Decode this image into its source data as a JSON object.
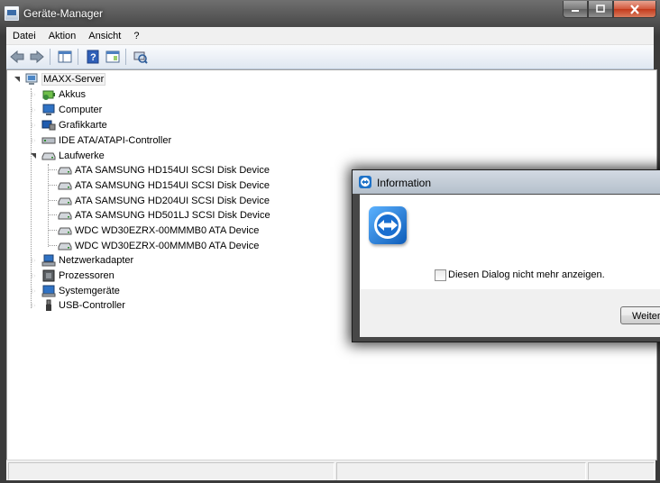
{
  "window": {
    "title": "Geräte-Manager"
  },
  "menu": [
    "Datei",
    "Aktion",
    "Ansicht",
    "?"
  ],
  "tree": {
    "root": "MAXX-Server",
    "categories": [
      {
        "label": "Akkus",
        "icon": "battery-icon",
        "expanded": false
      },
      {
        "label": "Computer",
        "icon": "computer-icon",
        "expanded": false
      },
      {
        "label": "Grafikkarte",
        "icon": "display-adapter-icon",
        "expanded": false
      },
      {
        "label": "IDE ATA/ATAPI-Controller",
        "icon": "ide-controller-icon",
        "expanded": false
      },
      {
        "label": "Laufwerke",
        "icon": "disk-drive-icon",
        "expanded": true,
        "children": [
          "ATA SAMSUNG HD154UI SCSI Disk Device",
          "ATA SAMSUNG HD154UI SCSI Disk Device",
          "ATA SAMSUNG HD204UI SCSI Disk Device",
          "ATA SAMSUNG HD501LJ SCSI Disk Device",
          "WDC WD30EZRX-00MMMB0 ATA Device",
          "WDC WD30EZRX-00MMMB0 ATA Device"
        ]
      },
      {
        "label": "Netzwerkadapter",
        "icon": "network-adapter-icon",
        "expanded": false
      },
      {
        "label": "Prozessoren",
        "icon": "processor-icon",
        "expanded": false
      },
      {
        "label": "Systemgeräte",
        "icon": "system-devices-icon",
        "expanded": false
      },
      {
        "label": "USB-Controller",
        "icon": "usb-icon",
        "expanded": false
      }
    ]
  },
  "dialog": {
    "title": "Information",
    "checkbox_label": "Diesen Dialog nicht mehr anzeigen.",
    "checkbox_checked": false,
    "button_label": "Weiter"
  }
}
